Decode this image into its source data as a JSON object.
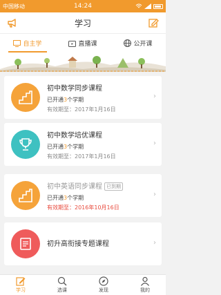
{
  "status_bar": {
    "carrier": "中国移动",
    "time": "14:24"
  },
  "header": {
    "title": "学习",
    "left_icon": "megaphone-icon",
    "right_icon": "edit-icon"
  },
  "tabs": [
    {
      "label": "自主学",
      "icon": "monitor-icon",
      "active": true
    },
    {
      "label": "直播课",
      "icon": "tv-icon",
      "active": false
    },
    {
      "label": "公开课",
      "icon": "globe-icon",
      "active": false
    }
  ],
  "courses": [
    {
      "name": "初中数学同步课程",
      "status_prefix": "已开通",
      "status_num": "3",
      "status_suffix": "个学期",
      "expiry": "有效期至：2017年1月16日",
      "expired_tag": "",
      "icon": "stairs-icon",
      "color": "#f5a33a"
    },
    {
      "name": "初中数学培优课程",
      "status_prefix": "已开通",
      "status_num": "3",
      "status_suffix": "个学期",
      "expiry": "有效期至：2017年1月16日",
      "expired_tag": "",
      "icon": "trophy-icon",
      "color": "#3ec1c1"
    },
    {
      "name": "初中英语同步课程",
      "status_prefix": "已开通",
      "status_num": "3",
      "status_suffix": "个学期",
      "expiry": "有效期至：2016年10月16日",
      "expired_tag": "已到期",
      "icon": "stairs-icon",
      "color": "#f5a33a"
    },
    {
      "name": "初升高衔接专题课程",
      "status_prefix": "",
      "status_num": "",
      "status_suffix": "",
      "expiry": "",
      "expired_tag": "",
      "icon": "book-icon",
      "color": "#ef5b5b"
    }
  ],
  "bottom_nav": [
    {
      "label": "学习",
      "icon": "pencil-note-icon",
      "active": true
    },
    {
      "label": "选课",
      "icon": "search-icon",
      "active": false
    },
    {
      "label": "发现",
      "icon": "compass-icon",
      "active": false
    },
    {
      "label": "我的",
      "icon": "user-icon",
      "active": false
    }
  ]
}
